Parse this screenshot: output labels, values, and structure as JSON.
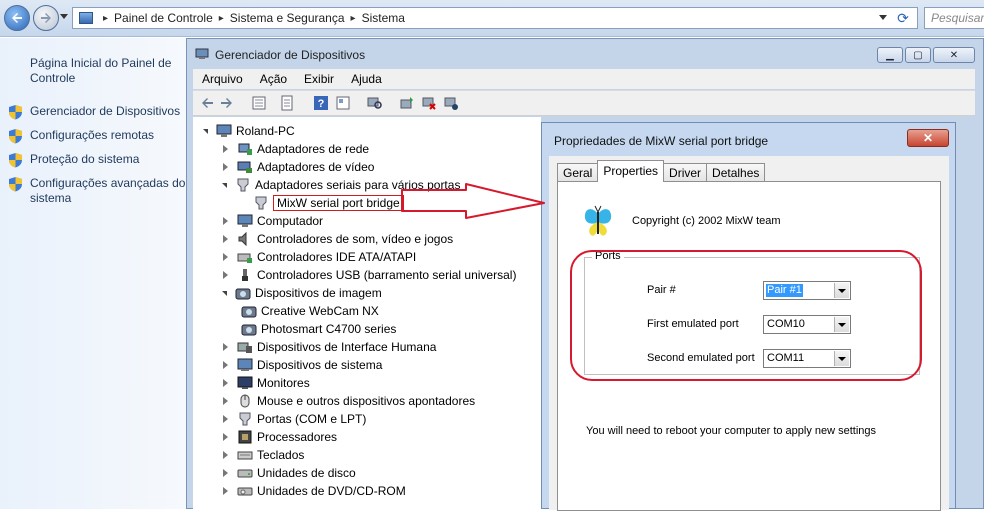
{
  "address": {
    "crumbs": [
      "Painel de Controle",
      "Sistema e Segurança",
      "Sistema"
    ],
    "search_placeholder": "Pesquisar"
  },
  "left_pane": {
    "home": "Página Inicial do Painel de Controle",
    "links": [
      "Gerenciador de Dispositivos",
      "Configurações remotas",
      "Proteção do sistema",
      "Configurações avançadas do sistema"
    ]
  },
  "device_manager": {
    "title": "Gerenciador de Dispositivos",
    "menu": [
      "Arquivo",
      "Ação",
      "Exibir",
      "Ajuda"
    ],
    "tree": {
      "root": "Roland-PC",
      "items": [
        "Adaptadores de rede",
        "Adaptadores de vídeo",
        "Adaptadores seriais para vários portas",
        "MixW serial port bridge",
        "Computador",
        "Controladores de som, vídeo e jogos",
        "Controladores IDE ATA/ATAPI",
        "Controladores USB (barramento serial universal)",
        "Dispositivos de imagem",
        "Creative WebCam NX",
        "Photosmart C4700 series",
        "Dispositivos de Interface Humana",
        "Dispositivos de sistema",
        "Monitores",
        "Mouse e outros dispositivos apontadores",
        "Portas (COM e LPT)",
        "Processadores",
        "Teclados",
        "Unidades de disco",
        "Unidades de DVD/CD-ROM"
      ]
    }
  },
  "properties": {
    "title": "Propriedades de MixW serial port bridge",
    "close_label": "✕",
    "tabs": [
      "Geral",
      "Properties",
      "Driver",
      "Detalhes"
    ],
    "copyright": "Copyright (c) 2002  MixW team",
    "group_label": "Ports",
    "fields": [
      {
        "label": "Pair #",
        "value": "Pair #1"
      },
      {
        "label": "First emulated port",
        "value": "COM10"
      },
      {
        "label": "Second emulated port",
        "value": "COM11"
      }
    ],
    "note": "You will need to reboot your computer to apply new settings"
  },
  "colors": {
    "annotation": "#d6192c",
    "accent": "#2a66b8"
  }
}
